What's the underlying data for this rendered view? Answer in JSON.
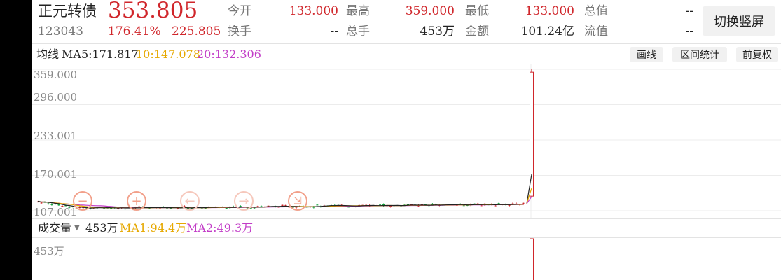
{
  "quote": {
    "name": "正元转债",
    "code": "123043",
    "price": "353.805",
    "change_pct": "176.41%",
    "change_abs": "225.805",
    "fields": [
      {
        "label": "今开",
        "value": "133.000",
        "color": "#d0262b"
      },
      {
        "label": "最高",
        "value": "359.000",
        "color": "#d0262b"
      },
      {
        "label": "最低",
        "value": "133.000",
        "color": "#d0262b"
      },
      {
        "label": "总值",
        "value": "--",
        "color": "#222222"
      },
      {
        "label": "换手",
        "value": "--",
        "color": "#222222"
      },
      {
        "label": "总手",
        "value": "453万",
        "color": "#222222"
      },
      {
        "label": "金额",
        "value": "101.24亿",
        "color": "#222222"
      },
      {
        "label": "流值",
        "value": "--",
        "color": "#222222"
      }
    ],
    "switch_button": "切换竖屏"
  },
  "ma_bar": {
    "label": "均线",
    "ma5": "MA5:171.817",
    "ma10": "10:147.078",
    "ma20": "20:132.306",
    "tools": [
      "画线",
      "区间统计",
      "前复权"
    ]
  },
  "volume_bar": {
    "selector": "成交量",
    "value": "453万",
    "ma1": "MA1:94.4万",
    "ma2": "MA2:49.3万",
    "axis_top": "453万"
  },
  "colors": {
    "up": "#d0262b",
    "down": "#0f9d3a",
    "ma5": "#222222",
    "ma10": "#e6a800",
    "ma20": "#c23cc7"
  },
  "icons": [
    "minus-icon",
    "plus-icon",
    "arrow-left-icon",
    "arrow-right-icon",
    "collapse-icon"
  ],
  "chart_data": {
    "type": "candlestick",
    "y_ticks": [
      "359.000",
      "296.000",
      "233.001",
      "170.001",
      "107.001"
    ],
    "ylim": [
      107.001,
      359.0
    ],
    "grid": true,
    "series": [
      {
        "name": "MA5",
        "value": 171.817
      },
      {
        "name": "MA10",
        "value": 147.078
      },
      {
        "name": "MA20",
        "value": 132.306
      }
    ],
    "last_candle": {
      "open": 133.0,
      "high": 359.0,
      "low": 133.0,
      "close": 353.805
    },
    "volume": {
      "last": "453万",
      "ma1": "94.4万",
      "ma2": "49.3万"
    }
  }
}
